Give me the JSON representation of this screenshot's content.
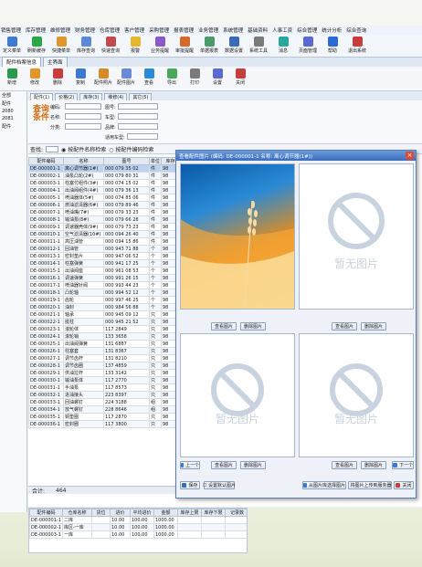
{
  "menu": [
    "销售管理",
    "库存管理",
    "维修管理",
    "财务管理",
    "仓库管理",
    "客户管理",
    "采购管理",
    "报表管理",
    "业务管理",
    "系统管理",
    "基础资料",
    "人事工资",
    "综合管理",
    "统计分析",
    "综合查询"
  ],
  "toolbar": [
    {
      "label": "定义菜单",
      "color": "#3d7bd4"
    },
    {
      "label": "刷新缓存",
      "color": "#2aa846"
    },
    {
      "label": "快捷菜单",
      "color": "#e0962a"
    },
    {
      "label": "库存查询",
      "color": "#5a8ad8"
    },
    {
      "label": "快速查询",
      "color": "#c24a4a"
    },
    {
      "label": "报警",
      "color": "#e3b62c"
    },
    {
      "label": "业务提醒",
      "color": "#8a5ac9"
    },
    {
      "label": "审批提醒",
      "color": "#d66a2a"
    },
    {
      "label": "单据报表",
      "color": "#4a9a6a"
    },
    {
      "label": "数据设置",
      "color": "#3a6ab8"
    },
    {
      "label": "系统工具",
      "color": "#7a7a7a"
    },
    {
      "label": "消息",
      "color": "#2aa8a0"
    },
    {
      "label": "页面管理",
      "color": "#5a6ad0"
    },
    {
      "label": "帮助",
      "color": "#2a6ad6"
    },
    {
      "label": "退出系统",
      "color": "#c83c3c"
    }
  ],
  "tabs_top": [
    "配件档案信息",
    "主界面"
  ],
  "subtoolbar": [
    {
      "label": "新增",
      "color": "#2a9a4a"
    },
    {
      "label": "修改",
      "color": "#e0962a"
    },
    {
      "label": "删除",
      "color": "#c83c3c"
    },
    {
      "label": "复制",
      "color": "#3a7ad0"
    },
    {
      "label": "配件照片",
      "color": "#d68a2a"
    },
    {
      "label": "配件图片",
      "color": "#6a8ad8"
    },
    {
      "label": "查看",
      "color": "#2a8ad6"
    },
    {
      "label": "导出",
      "color": "#4aa85a"
    },
    {
      "label": "打印",
      "color": "#7a7a7a"
    },
    {
      "label": "设置",
      "color": "#5a6ad0"
    },
    {
      "label": "关闭",
      "color": "#c83c3c"
    }
  ],
  "left_panel": [
    "全部",
    "配件",
    "2080",
    "2081",
    "配件"
  ],
  "tabs2": [
    "配件(1)",
    "价格(2)",
    "库存(3)",
    "维修(4)",
    "其它(5)"
  ],
  "filters": {
    "logo": "查询条件",
    "labels": [
      "编码:",
      "名称:",
      "分类:",
      "图号:",
      "车型:",
      "品牌:",
      "适用车型:"
    ]
  },
  "findbar": {
    "label": "查找:",
    "options": [
      "按配件名称检索",
      "按配件编码检索"
    ]
  },
  "grid": {
    "headers": [
      "配件编码",
      "名称",
      "图号",
      "单位",
      "库存"
    ],
    "rows": [
      [
        "DE-000001-1",
        "离心调节器(1#)",
        "000 079 35 02",
        "件",
        "98"
      ],
      [
        "DE-000002-1",
        "油泵凸轮(2#)",
        "000 079 80 31",
        "件",
        "98"
      ],
      [
        "DE-000003-1",
        "柱塞付组件(3#)",
        "000 074 15 02",
        "件",
        "98"
      ],
      [
        "DE-000004-1",
        "出油阀组件(4#)",
        "000 079 36 13",
        "件",
        "98"
      ],
      [
        "DE-000005-1",
        "喷油器体(5#)",
        "000 074 85 06",
        "件",
        "98"
      ],
      [
        "DE-000006-1",
        "燃油滤清器(6#)",
        "000 079 89 46",
        "件",
        "98"
      ],
      [
        "DE-000007-1",
        "喷油嘴(7#)",
        "000 079 33 23",
        "件",
        "98"
      ],
      [
        "DE-000008-1",
        "输油泵(8#)",
        "000 079 66 28",
        "件",
        "98"
      ],
      [
        "DE-000009-1",
        "调速器壳体(9#)",
        "000 079 73 23",
        "件",
        "98"
      ],
      [
        "DE-000010-1",
        "空气滤清器(10#)",
        "000 094 26 40",
        "件",
        "98"
      ],
      [
        "DE-000011-1",
        "高压油管",
        "000 094 15 86",
        "件",
        "98"
      ],
      [
        "DE-000012-1",
        "回油管",
        "000 943 71 88",
        "个",
        "98"
      ],
      [
        "DE-000013-1",
        "密封垫片",
        "000 947 06 52",
        "个",
        "98"
      ],
      [
        "DE-000014-1",
        "柱塞弹簧",
        "000 941 17 25",
        "个",
        "98"
      ],
      [
        "DE-000015-1",
        "出油阀座",
        "000 961 08 53",
        "个",
        "98"
      ],
      [
        "DE-000016-1",
        "调速弹簧",
        "000 991 26 15",
        "个",
        "98"
      ],
      [
        "DE-000017-1",
        "喷油器针阀",
        "000 993 44 23",
        "个",
        "98"
      ],
      [
        "DE-000018-1",
        "凸轮轴",
        "000 994 52 12",
        "个",
        "98"
      ],
      [
        "DE-000019-1",
        "齿轮",
        "000 997 46 25",
        "个",
        "98"
      ],
      [
        "DE-000020-1",
        "油封",
        "000 984 56 88",
        "个",
        "98"
      ],
      [
        "DE-000021-1",
        "轴承",
        "000 945 09 12",
        "只",
        "98"
      ],
      [
        "DE-000022-1",
        "挺柱",
        "000 945 21 52",
        "只",
        "98"
      ],
      [
        "DE-000023-1",
        "滚轮体",
        "117 2849",
        "只",
        "98"
      ],
      [
        "DE-000024-1",
        "滚轮销",
        "133 3658",
        "只",
        "98"
      ],
      [
        "DE-000025-1",
        "出油阀弹簧",
        "131 6887",
        "只",
        "98"
      ],
      [
        "DE-000026-1",
        "柱塞套",
        "131 8367",
        "只",
        "98"
      ],
      [
        "DE-000027-1",
        "调节齿杆",
        "131 8210",
        "只",
        "98"
      ],
      [
        "DE-000028-1",
        "调节齿圈",
        "137 4859",
        "只",
        "98"
      ],
      [
        "DE-000029-1",
        "供油拉杆",
        "133 3142",
        "只",
        "98"
      ],
      [
        "DE-000030-1",
        "输油泵体",
        "117 2770",
        "只",
        "98"
      ],
      [
        "DE-000031-1",
        "手油泵",
        "117 8573",
        "只",
        "98"
      ],
      [
        "DE-000032-1",
        "进油接头",
        "223 8397",
        "只",
        "98"
      ],
      [
        "DE-000033-1",
        "回油螺钉",
        "224 3188",
        "组",
        "98"
      ],
      [
        "DE-000034-1",
        "放气螺钉",
        "228 8646",
        "组",
        "98"
      ],
      [
        "DE-000035-1",
        "铜垫圈",
        "117 2870",
        "只",
        "98"
      ],
      [
        "DE-000036-1",
        "密封圈",
        "117 3800",
        "只",
        "98"
      ]
    ],
    "selected_index": 0
  },
  "sum": {
    "label": "合计:",
    "value": "464"
  },
  "bottom_grid": {
    "headers": [
      "配件编码",
      "仓库名称",
      "货位",
      "进价",
      "平均进价",
      "金额",
      "库存上限",
      "库存下限",
      "记录数"
    ],
    "rows": [
      [
        "DE-000001-1",
        "二库",
        "",
        "10.00",
        "100.00",
        "1000.00",
        "",
        "",
        ""
      ],
      [
        "DE-000002-1",
        "库区-一库",
        "",
        "10.00",
        "100.00",
        "1000.00",
        "",
        "",
        ""
      ],
      [
        "DE-000003-1",
        "一库",
        "",
        "10.00",
        "100.00",
        "1000.00",
        "",
        "",
        ""
      ]
    ]
  },
  "dialog": {
    "title": "查看配件图片 (编码: DE-000001-1  名称: 离心调节器(1#))",
    "close": "×",
    "placeholder_text": "暂无图片",
    "buttons": {
      "p1_view": "查看图片",
      "p1_delete": "删除图片",
      "p2_view": "查看图片",
      "p2_delete": "删除图片",
      "p3_view": "查看图片",
      "p3_delete": "删除图片",
      "p4_view": "查看图片",
      "p4_delete": "删除图片",
      "prev": "上一个",
      "next": "下一个",
      "save": "保存",
      "set_default": "设置默认图片",
      "upload_cur": "从图片库选择图片",
      "upload_all": "将图片上传到服务器",
      "exit": "关闭"
    }
  }
}
